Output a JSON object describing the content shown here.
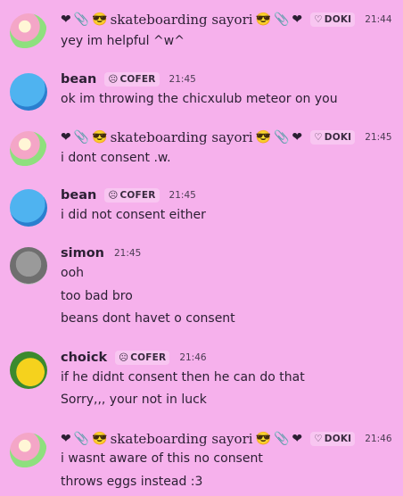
{
  "messages": [
    {
      "author": "skateboarding sayori",
      "badge": "DOKI",
      "badge_icon": "heart-outline-icon",
      "time": "21:44",
      "lines": [
        "yey im helpful ^w^"
      ]
    },
    {
      "author": "bean",
      "badge": "COFER",
      "badge_icon": "face-icon",
      "time": "21:45",
      "lines": [
        "ok im throwing the chicxulub meteor on you"
      ]
    },
    {
      "author": "skateboarding sayori",
      "badge": "DOKI",
      "badge_icon": "heart-outline-icon",
      "time": "21:45",
      "lines": [
        "i dont consent .w."
      ]
    },
    {
      "author": "bean",
      "badge": "COFER",
      "badge_icon": "face-icon",
      "time": "21:45",
      "lines": [
        "i did not consent either"
      ]
    },
    {
      "author": "simon",
      "badge": "",
      "time": "21:45",
      "lines": [
        "ooh",
        "too bad bro",
        "beans dont havet o consent"
      ]
    },
    {
      "author": "choick",
      "badge": "COFER",
      "badge_icon": "face-icon",
      "time": "21:46",
      "lines": [
        "if he didnt consent then he can do that",
        "Sorry,,, your not in luck"
      ]
    },
    {
      "author": "skateboarding sayori",
      "badge": "DOKI",
      "badge_icon": "heart-outline-icon",
      "time": "21:46",
      "lines": [
        "i wasnt aware of this no consent",
        "throws eggs instead :3"
      ]
    }
  ],
  "decor": {
    "prefix_emoji": "❤️🧷😎",
    "suffix_emoji": "😎🧷❤️",
    "cofer_emoji": "😶"
  }
}
